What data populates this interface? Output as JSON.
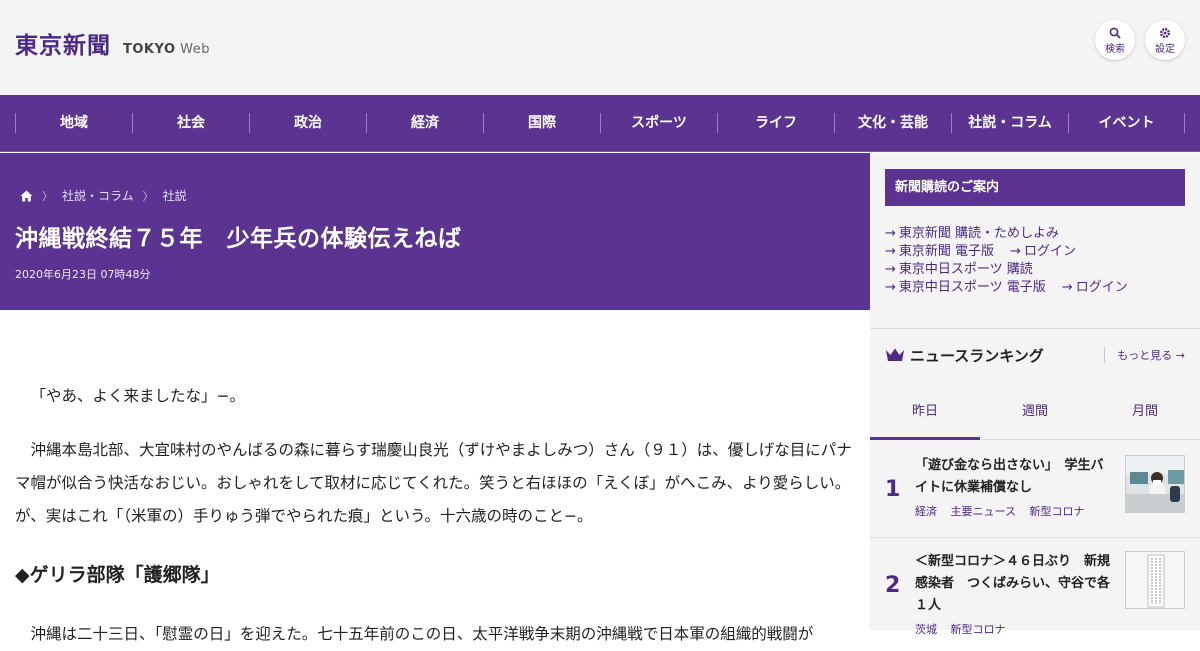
{
  "header": {
    "logo_text": "東京新聞",
    "logo_sub_bold": "TOKYO",
    "logo_sub_light": "Web",
    "search_label": "検索",
    "settings_label": "設定"
  },
  "nav": {
    "items": [
      "地域",
      "社会",
      "政治",
      "経済",
      "国際",
      "スポーツ",
      "ライフ",
      "文化・芸能",
      "社説・コラム",
      "イベント"
    ]
  },
  "article": {
    "breadcrumbs": [
      "社説・コラム",
      "社説"
    ],
    "title": "沖縄戦終結７５年　少年兵の体験伝えねば",
    "date": "2020年6月23日 07時48分",
    "paragraphs": [
      "「やあ、よく来ましたな」−。",
      "沖縄本島北部、大宜味村のやんばるの森に暮らす瑞慶山良光（ずけやまよしみつ）さん（９１）は、優しげな目にパナマ帽が似合う快活なおじい。おしゃれをして取材に応じてくれた。笑うと右ほほの「えくぼ」がへこみ、より愛らしい。が、実はこれ「（米軍の）手りゅう弾でやられた痕」という。十六歳の時のこと−。",
      "沖縄は二十三日、「慰霊の日」を迎えた。七十五年前のこの日、太平洋戦争末期の沖縄戦で日本軍の組織的戦闘が"
    ],
    "subheading": "◆ゲリラ部隊「護郷隊」"
  },
  "sidebar": {
    "subscribe_title": "新聞購読のご案内",
    "links": [
      [
        "東京新聞 購読・ためしよみ"
      ],
      [
        "東京新聞 電子版",
        "ログイン"
      ],
      [
        "東京中日スポーツ 購読"
      ],
      [
        "東京中日スポーツ 電子版",
        "ログイン"
      ]
    ],
    "ranking_title": "ニュースランキング",
    "ranking_more": "もっと見る",
    "tabs": [
      "昨日",
      "週間",
      "月間"
    ],
    "active_tab": 0,
    "ranking": [
      {
        "rank": "1",
        "title": "「遊び金なら出さない」　学生バイトに休業補償なし",
        "tags": [
          "経済",
          "主要ニュース",
          "新型コロナ"
        ]
      },
      {
        "rank": "2",
        "title": "＜新型コロナ＞４６日ぶり　新規感染者　つくばみらい、守谷で各１人",
        "tags": [
          "茨城",
          "新型コロナ"
        ]
      }
    ]
  },
  "colors": {
    "brand_purple": "#5b3390",
    "accent_purple": "#4b2a86"
  }
}
